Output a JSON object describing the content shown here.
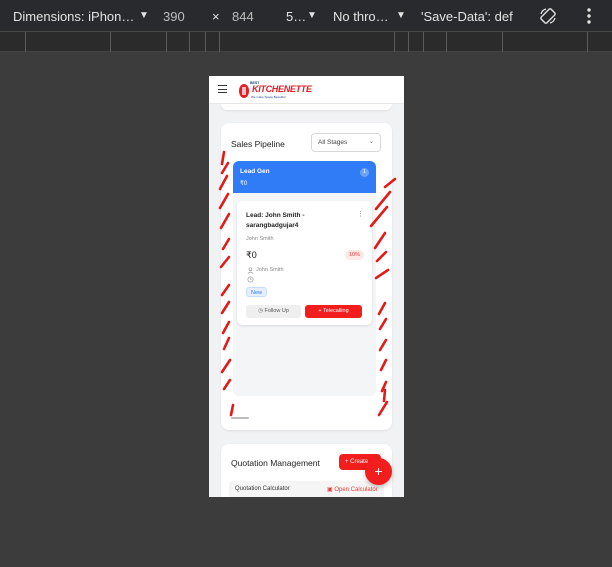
{
  "devtools": {
    "device_label": "Dimensions: iPhon…",
    "width_value": "390",
    "times_sign": "×",
    "height_value": "844",
    "zoom_label": "5…",
    "throttle_label": "No thro…",
    "save_data_label": "'Save-Data': def",
    "rotate_icon": "rotate-icon",
    "more_icon": "more-vertical-icon"
  },
  "app": {
    "menu_icon": "hamburger-menu-icon",
    "logo_text": "KITCHENETTE",
    "logo_colors": {
      "primary": "#e41e26",
      "secondary": "#1b3e8f"
    }
  },
  "pipeline": {
    "title": "Sales Pipeline",
    "stage_select": "All Stages",
    "column": {
      "title": "Lead Gen",
      "count": "1",
      "amount": "₹0",
      "color": "#2f7cf6"
    },
    "lead": {
      "title": "Lead: John Smith - sarangbadgujar4",
      "contact": "John Smith",
      "amount": "₹0",
      "probability": "10%",
      "owner": "John Smith",
      "status": "New",
      "follow_up_label": "Follow Up",
      "telecalling_label": "Telecalling"
    }
  },
  "quotation": {
    "title": "Quotation Management",
    "create_label": "Create",
    "calculator_label": "Quotation Calculator",
    "open_calculator_label": "Open Calculator"
  },
  "fab_label": "+",
  "accent_color": "#f21d1d"
}
